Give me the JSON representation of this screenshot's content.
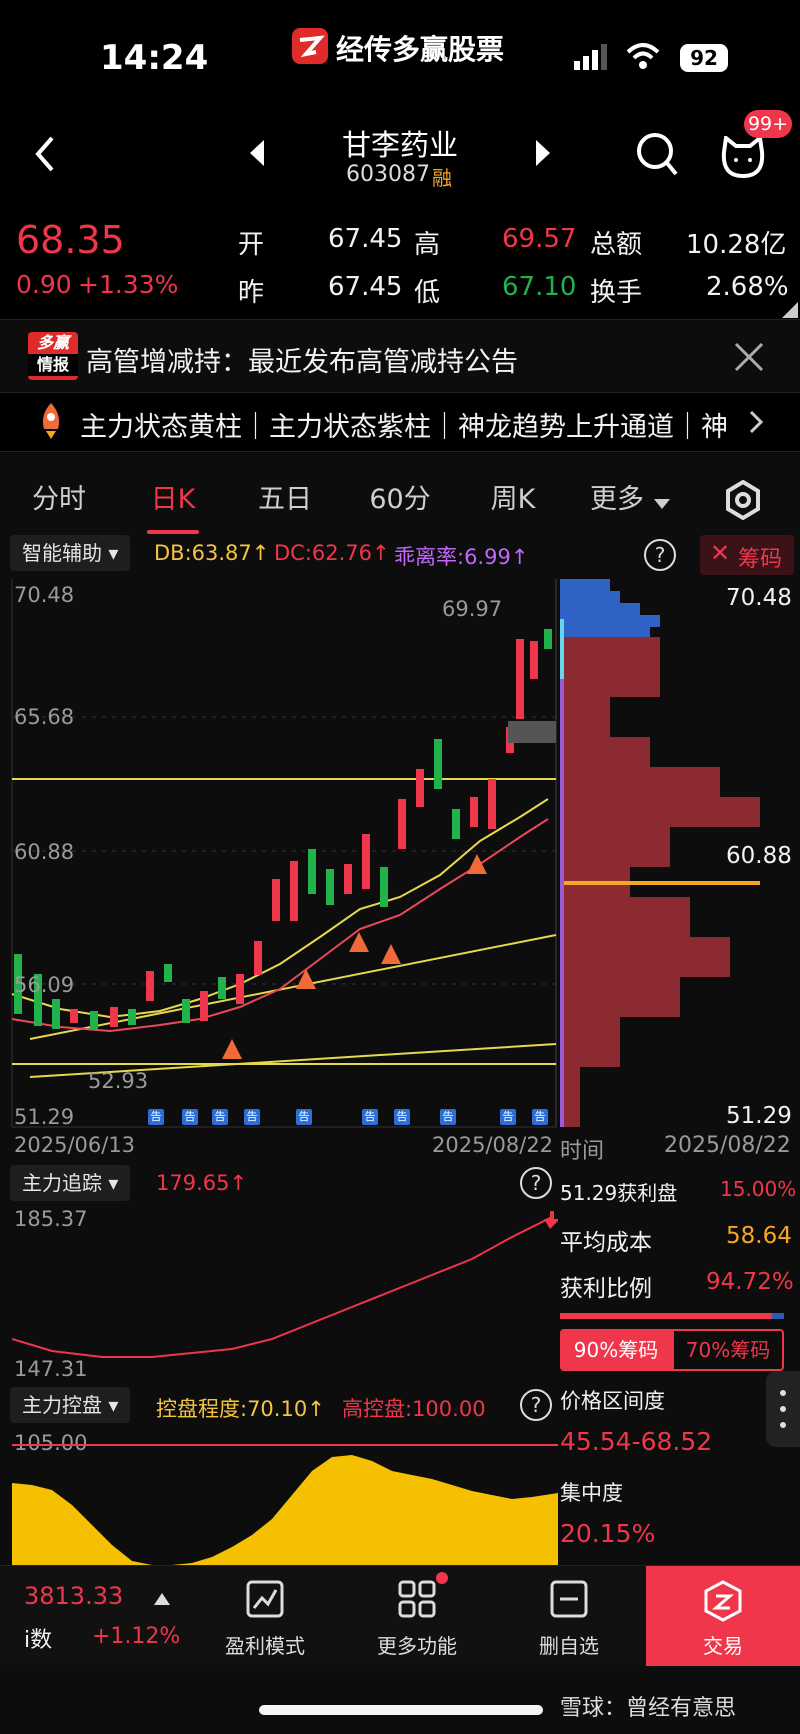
{
  "status": {
    "time": "14:24",
    "app_name": "经传多赢股票",
    "battery": "92"
  },
  "header": {
    "title": "甘李药业",
    "code": "603087",
    "margin_badge": "融",
    "notif_badge": "99+"
  },
  "quote": {
    "price": "68.35",
    "change": "0.90",
    "change_pct": "+1.33%",
    "open_label": "开",
    "open": "67.45",
    "high_label": "高",
    "high": "69.57",
    "amount_label": "总额",
    "amount": "10.28亿",
    "prev_label": "昨",
    "prev": "67.45",
    "low_label": "低",
    "low": "67.10",
    "turnover_label": "换手",
    "turnover": "2.68%"
  },
  "news": {
    "badge_top": "多赢",
    "badge_bottom": "情报",
    "text": "高管增减持：最近发布高管减持公告"
  },
  "ticker": {
    "text": "主力状态黄柱｜主力状态紫柱｜神龙趋势上升通道｜神"
  },
  "tabs": [
    "分时",
    "日K",
    "五日",
    "60分",
    "周K",
    "更多"
  ],
  "kline": {
    "assist_label": "智能辅助",
    "db": "DB:63.87↑",
    "dc": "DC:62.76↑",
    "deviation": "乖离率:6.99↑",
    "chips_label": "筹码",
    "y_top": "70.48",
    "y_mid1": "65.68",
    "y_mid2": "60.88",
    "y_low": "56.09",
    "y_bottom": "51.29",
    "high_marker": "69.97",
    "low_marker": "52.93",
    "date_start": "2025/06/13",
    "date_end": "2025/08/22",
    "signal_label": "告"
  },
  "chips": {
    "top": "70.48",
    "mid": "60.88",
    "bottom": "51.29",
    "time_label": "时间",
    "time_value": "2025/08/22",
    "profit_label": "51.29获利盘",
    "profit_value": "15.00%",
    "avg_cost_label": "平均成本",
    "avg_cost_value": "58.64",
    "profit_ratio_label": "获利比例",
    "profit_ratio_value": "94.72%",
    "btn_90": "90%筹码",
    "btn_70": "70%筹码",
    "range_label": "价格区间度",
    "range_value": "45.54-68.52",
    "conc_label": "集中度",
    "conc_value": "20.15%"
  },
  "tracking": {
    "label": "主力追踪",
    "value": "179.65↑",
    "y_top": "185.37",
    "y_bottom": "147.31"
  },
  "control": {
    "label": "主力控盘",
    "degree": "控盘程度:70.10↑",
    "high": "高控盘:100.00",
    "y_top": "105.00"
  },
  "bottom_bar": {
    "index_value": "3813.33",
    "index_label": "i数",
    "index_change": "+1.12%",
    "items": [
      "盈利模式",
      "更多功能",
      "删自选",
      "交易"
    ]
  },
  "watermark": "雪球：曾经有意思",
  "colors": {
    "up": "#f0364a",
    "down": "#21b24b",
    "accent": "#f5a623"
  }
}
